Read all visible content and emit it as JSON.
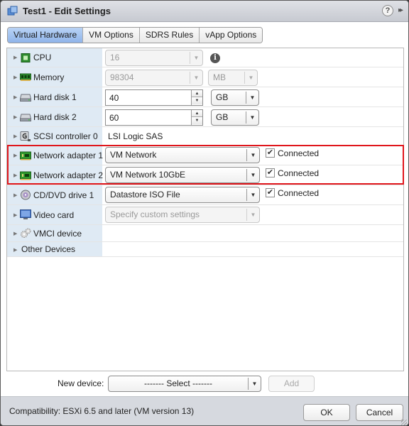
{
  "window": {
    "title": "Test1 - Edit Settings",
    "title_icon": "vm-icon",
    "help_icon": "?",
    "expand_icon": "▸▸"
  },
  "tabs": [
    {
      "label": "Virtual Hardware",
      "active": true
    },
    {
      "label": "VM Options",
      "active": false
    },
    {
      "label": "SDRS Rules",
      "active": false
    },
    {
      "label": "vApp Options",
      "active": false
    }
  ],
  "devices": {
    "cpu": {
      "label": "CPU",
      "icon": "cpu-icon",
      "value": "16",
      "info_icon": "i"
    },
    "memory": {
      "label": "Memory",
      "icon": "memory-icon",
      "value": "98304",
      "unit": "MB"
    },
    "hard_disk_1": {
      "label": "Hard disk 1",
      "icon": "hard-disk-icon",
      "value": "40",
      "unit": "GB"
    },
    "hard_disk_2": {
      "label": "Hard disk 2",
      "icon": "hard-disk-icon",
      "value": "60",
      "unit": "GB"
    },
    "scsi_controller_0": {
      "label": "SCSI controller 0",
      "icon": "scsi-controller-icon",
      "value": "LSI Logic SAS"
    },
    "network_adapter_1": {
      "label": "Network adapter 1",
      "icon": "network-adapter-icon",
      "value": "VM Network",
      "connected_label": "Connected",
      "connected": true
    },
    "network_adapter_2": {
      "label": "Network adapter 2",
      "icon": "network-adapter-icon",
      "value": "VM Network 10GbE",
      "connected_label": "Connected",
      "connected": true
    },
    "cd_dvd_drive_1": {
      "label": "CD/DVD drive 1",
      "icon": "cd-dvd-icon",
      "value": "Datastore ISO File",
      "connected_label": "Connected",
      "connected": true
    },
    "video_card": {
      "label": "Video card",
      "icon": "video-card-icon",
      "value": "Specify custom settings"
    },
    "vmci_device": {
      "label": "VMCI device",
      "icon": "vmci-device-icon"
    },
    "other_devices": {
      "label": "Other Devices"
    }
  },
  "new_device": {
    "label": "New device:",
    "select_value": "------- Select -------",
    "add_label": "Add"
  },
  "footer": {
    "compatibility": "Compatibility: ESXi 6.5 and later (VM version 13)",
    "ok_label": "OK",
    "cancel_label": "Cancel"
  },
  "colors": {
    "highlight": "#e0161c",
    "active_tab": "#9dbdec",
    "label_column": "#dfeaf4"
  },
  "glyphs": {
    "twisty": "▶",
    "dropdown": "▼",
    "spin_up": "▲",
    "spin_down": "▼",
    "check": "✔"
  }
}
